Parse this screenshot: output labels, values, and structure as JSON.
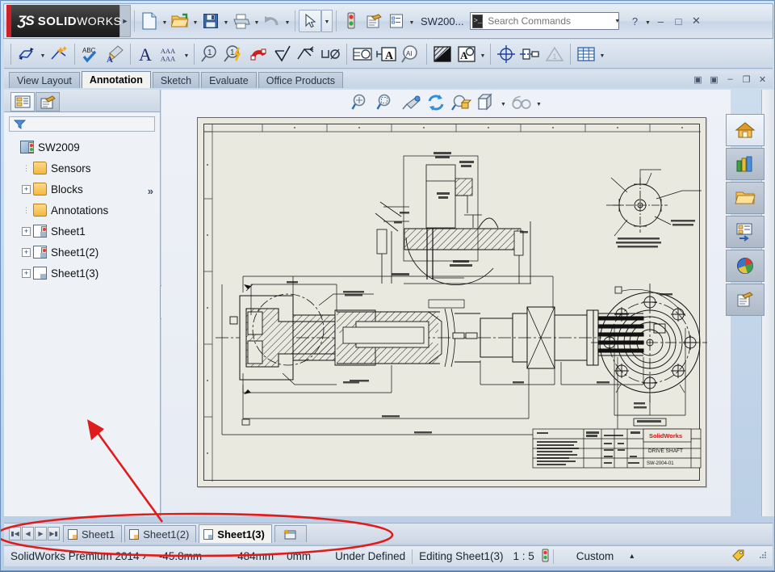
{
  "window": {
    "brand_ds": "ƷS",
    "brand_name_bold": "SOLID",
    "brand_name_light": "WORKS",
    "document_title": "SW200...",
    "help_icon": "help-question-icon",
    "minimize": "–",
    "maximize": "□",
    "close": "✕"
  },
  "search": {
    "placeholder": "Search Commands",
    "value": "",
    "icon": "magnifier-icon",
    "prompt_icon": "command-prompt-icon"
  },
  "quick_access": [
    {
      "name": "new-document",
      "icon": "new-file-icon",
      "has_dropdown": true
    },
    {
      "name": "open-document",
      "icon": "open-folder-icon",
      "has_dropdown": true
    },
    {
      "name": "save-document",
      "icon": "floppy-save-icon",
      "has_dropdown": true
    },
    {
      "name": "print-document",
      "icon": "printer-icon",
      "has_dropdown": true
    },
    {
      "name": "undo",
      "icon": "undo-arrow-icon",
      "has_dropdown": true
    },
    {
      "name": "select",
      "icon": "cursor-arrow-icon",
      "has_dropdown": true,
      "selected": true
    },
    {
      "name": "rebuild",
      "icon": "traffic-light-icon",
      "has_dropdown": false
    },
    {
      "name": "drawing-options",
      "icon": "notepad-pencil-icon",
      "has_dropdown": false
    },
    {
      "name": "options",
      "icon": "checklist-icon",
      "has_dropdown": true
    }
  ],
  "command_toolbar": [
    {
      "name": "smart-dimension",
      "icon": "smart-dimension-icon",
      "has_dropdown": true
    },
    {
      "name": "model-items",
      "icon": "model-items-icon",
      "has_dropdown": false
    },
    {
      "name": "spell-checker",
      "icon": "abc-spellcheck-icon",
      "has_dropdown": false
    },
    {
      "name": "format-painter",
      "icon": "format-painter-icon",
      "has_dropdown": false
    },
    {
      "name": "note",
      "icon": "letter-a-note-icon",
      "has_dropdown": false
    },
    {
      "name": "linear-note-pattern",
      "icon": "aaa-pattern-icon",
      "has_dropdown": true
    },
    {
      "name": "balloon",
      "icon": "balloon-icon",
      "has_dropdown": false
    },
    {
      "name": "auto-balloon",
      "icon": "auto-balloon-icon",
      "has_dropdown": false
    },
    {
      "name": "magnetic-line",
      "icon": "magnet-icon",
      "has_dropdown": false
    },
    {
      "name": "surface-finish",
      "icon": "surface-finish-icon",
      "has_dropdown": false
    },
    {
      "name": "weld-symbol",
      "icon": "weld-symbol-icon",
      "has_dropdown": false
    },
    {
      "name": "hole-callout",
      "icon": "hole-callout-icon",
      "has_dropdown": false
    },
    {
      "name": "revision-symbol",
      "icon": "revision-symbol-icon",
      "has_dropdown": false
    },
    {
      "name": "datum-feature",
      "icon": "datum-feature-icon",
      "has_dropdown": false
    },
    {
      "name": "area-hatch-fill",
      "icon": "area-hatch-magnifier-icon",
      "has_dropdown": false
    },
    {
      "name": "blocks",
      "icon": "hatch-block-icon",
      "has_dropdown": false
    },
    {
      "name": "make-block",
      "icon": "make-block-icon",
      "has_dropdown": true
    },
    {
      "name": "center-mark",
      "icon": "center-mark-icon",
      "has_dropdown": false
    },
    {
      "name": "centerline",
      "icon": "centerline-icon",
      "has_dropdown": false
    },
    {
      "name": "revision-cloud",
      "icon": "revision-triangle-icon",
      "has_dropdown": false
    },
    {
      "name": "tables",
      "icon": "table-grid-icon",
      "has_dropdown": true
    }
  ],
  "ribbon_tabs": [
    {
      "label": "View Layout",
      "active": false
    },
    {
      "label": "Annotation",
      "active": true
    },
    {
      "label": "Sketch",
      "active": false
    },
    {
      "label": "Evaluate",
      "active": false
    },
    {
      "label": "Office Products",
      "active": false
    }
  ],
  "graphics_window_controls": [
    {
      "name": "tile-left-icon",
      "glyph": "▣"
    },
    {
      "name": "tile-right-icon",
      "glyph": "▣"
    },
    {
      "name": "minimize-icon",
      "glyph": "–"
    },
    {
      "name": "restore-icon",
      "glyph": "❐"
    },
    {
      "name": "close-icon",
      "glyph": "✕"
    }
  ],
  "left_panel": {
    "tabs": [
      {
        "name": "feature-manager-tab",
        "icon": "feature-tree-icon",
        "active": false
      },
      {
        "name": "drawing-properties-tab",
        "icon": "drawing-sheet-icon",
        "active": true
      }
    ],
    "expand_glyph": "»",
    "filter_icon": "filter-funnel-icon",
    "filter_placeholder": "",
    "tree": [
      {
        "label": "SW2009",
        "icon": "assembly-icon",
        "expander": "none",
        "depth": 0
      },
      {
        "label": "Sensors",
        "icon": "folder-sensor-icon",
        "expander": "none",
        "depth": 1
      },
      {
        "label": "Blocks",
        "icon": "folder-blocks-icon",
        "expander": "plus",
        "depth": 1
      },
      {
        "label": "Annotations",
        "icon": "folder-annotations-icon",
        "expander": "none",
        "depth": 1
      },
      {
        "label": "Sheet1",
        "icon": "sheet-icon",
        "expander": "plus",
        "depth": 1
      },
      {
        "label": "Sheet1(2)",
        "icon": "sheet-icon",
        "expander": "plus",
        "depth": 1
      },
      {
        "label": "Sheet1(3)",
        "icon": "sheet-active-icon",
        "expander": "plus",
        "depth": 1
      }
    ]
  },
  "view_toolbar": [
    {
      "name": "zoom-to-fit",
      "icon": "zoom-fit-icon"
    },
    {
      "name": "zoom-to-area",
      "icon": "zoom-area-icon"
    },
    {
      "name": "previous-view",
      "icon": "previous-view-icon"
    },
    {
      "name": "rebuild-view",
      "icon": "rebuild-refresh-icon"
    },
    {
      "name": "update-view",
      "icon": "update-view-icon"
    },
    {
      "name": "display-style",
      "icon": "cube-display-style-icon",
      "has_dropdown": true
    },
    {
      "name": "view-orientation",
      "icon": "glasses-view-icon",
      "has_dropdown": true
    }
  ],
  "task_pane": [
    {
      "name": "solidworks-resources",
      "icon": "home-house-icon",
      "active": true
    },
    {
      "name": "design-library",
      "icon": "library-books-icon",
      "active": false
    },
    {
      "name": "file-explorer",
      "icon": "open-folder-icon",
      "active": false
    },
    {
      "name": "view-palette",
      "icon": "view-palette-icon",
      "active": false
    },
    {
      "name": "appearances-scenes",
      "icon": "appearance-sphere-icon",
      "active": false
    },
    {
      "name": "custom-properties",
      "icon": "notepad-pencil-icon",
      "active": false
    }
  ],
  "drawing": {
    "title_block": {
      "company": "SolidWorks",
      "part_title": "DRIVE SHAFT",
      "drawing_number": "SW-2004-01"
    },
    "views": [
      {
        "name": "section-view-top",
        "label": ""
      },
      {
        "name": "main-section-view",
        "label": ""
      },
      {
        "name": "flange-end-view",
        "label": ""
      },
      {
        "name": "detail-view-small",
        "label": ""
      }
    ]
  },
  "sheet_tabs": {
    "nav_first": "⏮",
    "nav_prev": "◀",
    "nav_next": "▶",
    "nav_last": "⏭",
    "tabs": [
      {
        "label": "Sheet1",
        "active": false
      },
      {
        "label": "Sheet1(2)",
        "active": false
      },
      {
        "label": "Sheet1(3)",
        "active": true
      }
    ],
    "add_sheet_icon": "add-sheet-icon"
  },
  "status_bar": {
    "product": "SolidWorks Premium 2014 ›",
    "coord_x": "-45.8mm",
    "coord_y": "484mm",
    "coord_z": "0mm",
    "sketch_state": "Under Defined",
    "editing": "Editing Sheet1(3)",
    "scale": "1 : 5",
    "rebuild_icon": "traffic-light-icon",
    "custom": "Custom",
    "custom_caret": "▴",
    "tag_icon": "yellow-tag-icon",
    "resize_grip": "resize-grip-icon"
  },
  "annotation": {
    "arrow_color": "#e01b1b",
    "ellipse_color": "#e01b1b",
    "arrow_name": "red-annotation-arrow",
    "ellipse_name": "red-annotation-ellipse"
  }
}
